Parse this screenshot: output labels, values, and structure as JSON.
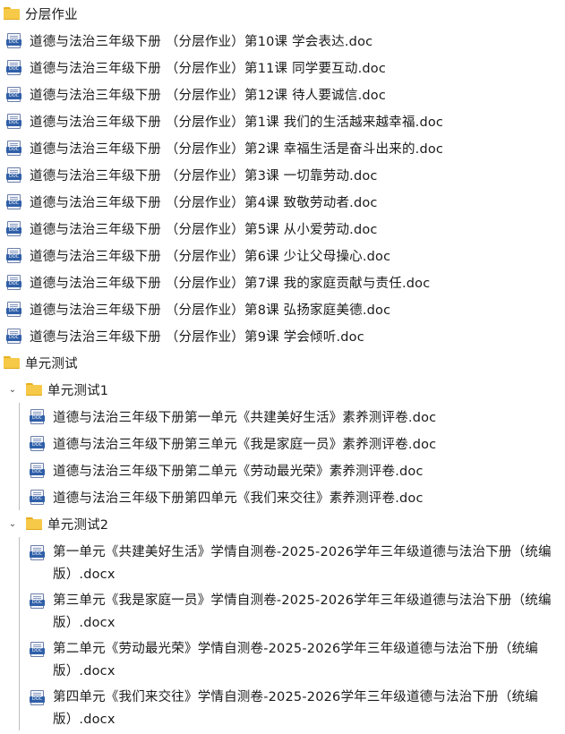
{
  "folder_fenceng": {
    "name": "分层作业",
    "files": [
      "道德与法治三年级下册 （分层作业）第10课 学会表达.doc",
      "道德与法治三年级下册 （分层作业）第11课 同学要互动.doc",
      "道德与法治三年级下册 （分层作业）第12课 待人要诚信.doc",
      "道德与法治三年级下册 （分层作业）第1课 我们的生活越来越幸福.doc",
      "道德与法治三年级下册 （分层作业）第2课 幸福生活是奋斗出来的.doc",
      "道德与法治三年级下册 （分层作业）第3课 一切靠劳动.doc",
      "道德与法治三年级下册 （分层作业）第4课 致敬劳动者.doc",
      "道德与法治三年级下册 （分层作业）第5课 从小爱劳动.doc",
      "道德与法治三年级下册 （分层作业）第6课 少让父母操心.doc",
      "道德与法治三年级下册 （分层作业）第7课 我的家庭贡献与责任.doc",
      "道德与法治三年级下册 （分层作业）第8课 弘扬家庭美德.doc",
      "道德与法治三年级下册 （分层作业）第9课 学会倾听.doc"
    ]
  },
  "folder_danyuan": {
    "name": "单元测试",
    "sub1": {
      "name": "单元测试1",
      "files": [
        "道德与法治三年级下册第一单元《共建美好生活》素养测评卷.doc",
        "道德与法治三年级下册第三单元《我是家庭一员》素养测评卷.doc",
        "道德与法治三年级下册第二单元《劳动最光荣》素养测评卷.doc",
        "道德与法治三年级下册第四单元《我们来交往》素养测评卷.doc"
      ]
    },
    "sub2": {
      "name": "单元测试2",
      "files": [
        "第一单元《共建美好生活》学情自测卷-2025-2026学年三年级道德与法治下册（统编版）.docx",
        "第三单元《我是家庭一员》学情自测卷-2025-2026学年三年级道德与法治下册（统编版）.docx",
        "第二单元《劳动最光荣》学情自测卷-2025-2026学年三年级道德与法治下册（统编版）.docx",
        "第四单元《我们来交往》学情自测卷-2025-2026学年三年级道德与法治下册（统编版）.docx"
      ]
    }
  },
  "icons": {
    "folder": "folder-icon",
    "doc": "word-doc-icon",
    "doc_badge_text": "DOC",
    "expanded": "chevron-down-icon"
  },
  "colors": {
    "folder_fill": "#f7c948",
    "doc_band": "#2f5fa8",
    "guide_line": "#bfbfbf"
  }
}
